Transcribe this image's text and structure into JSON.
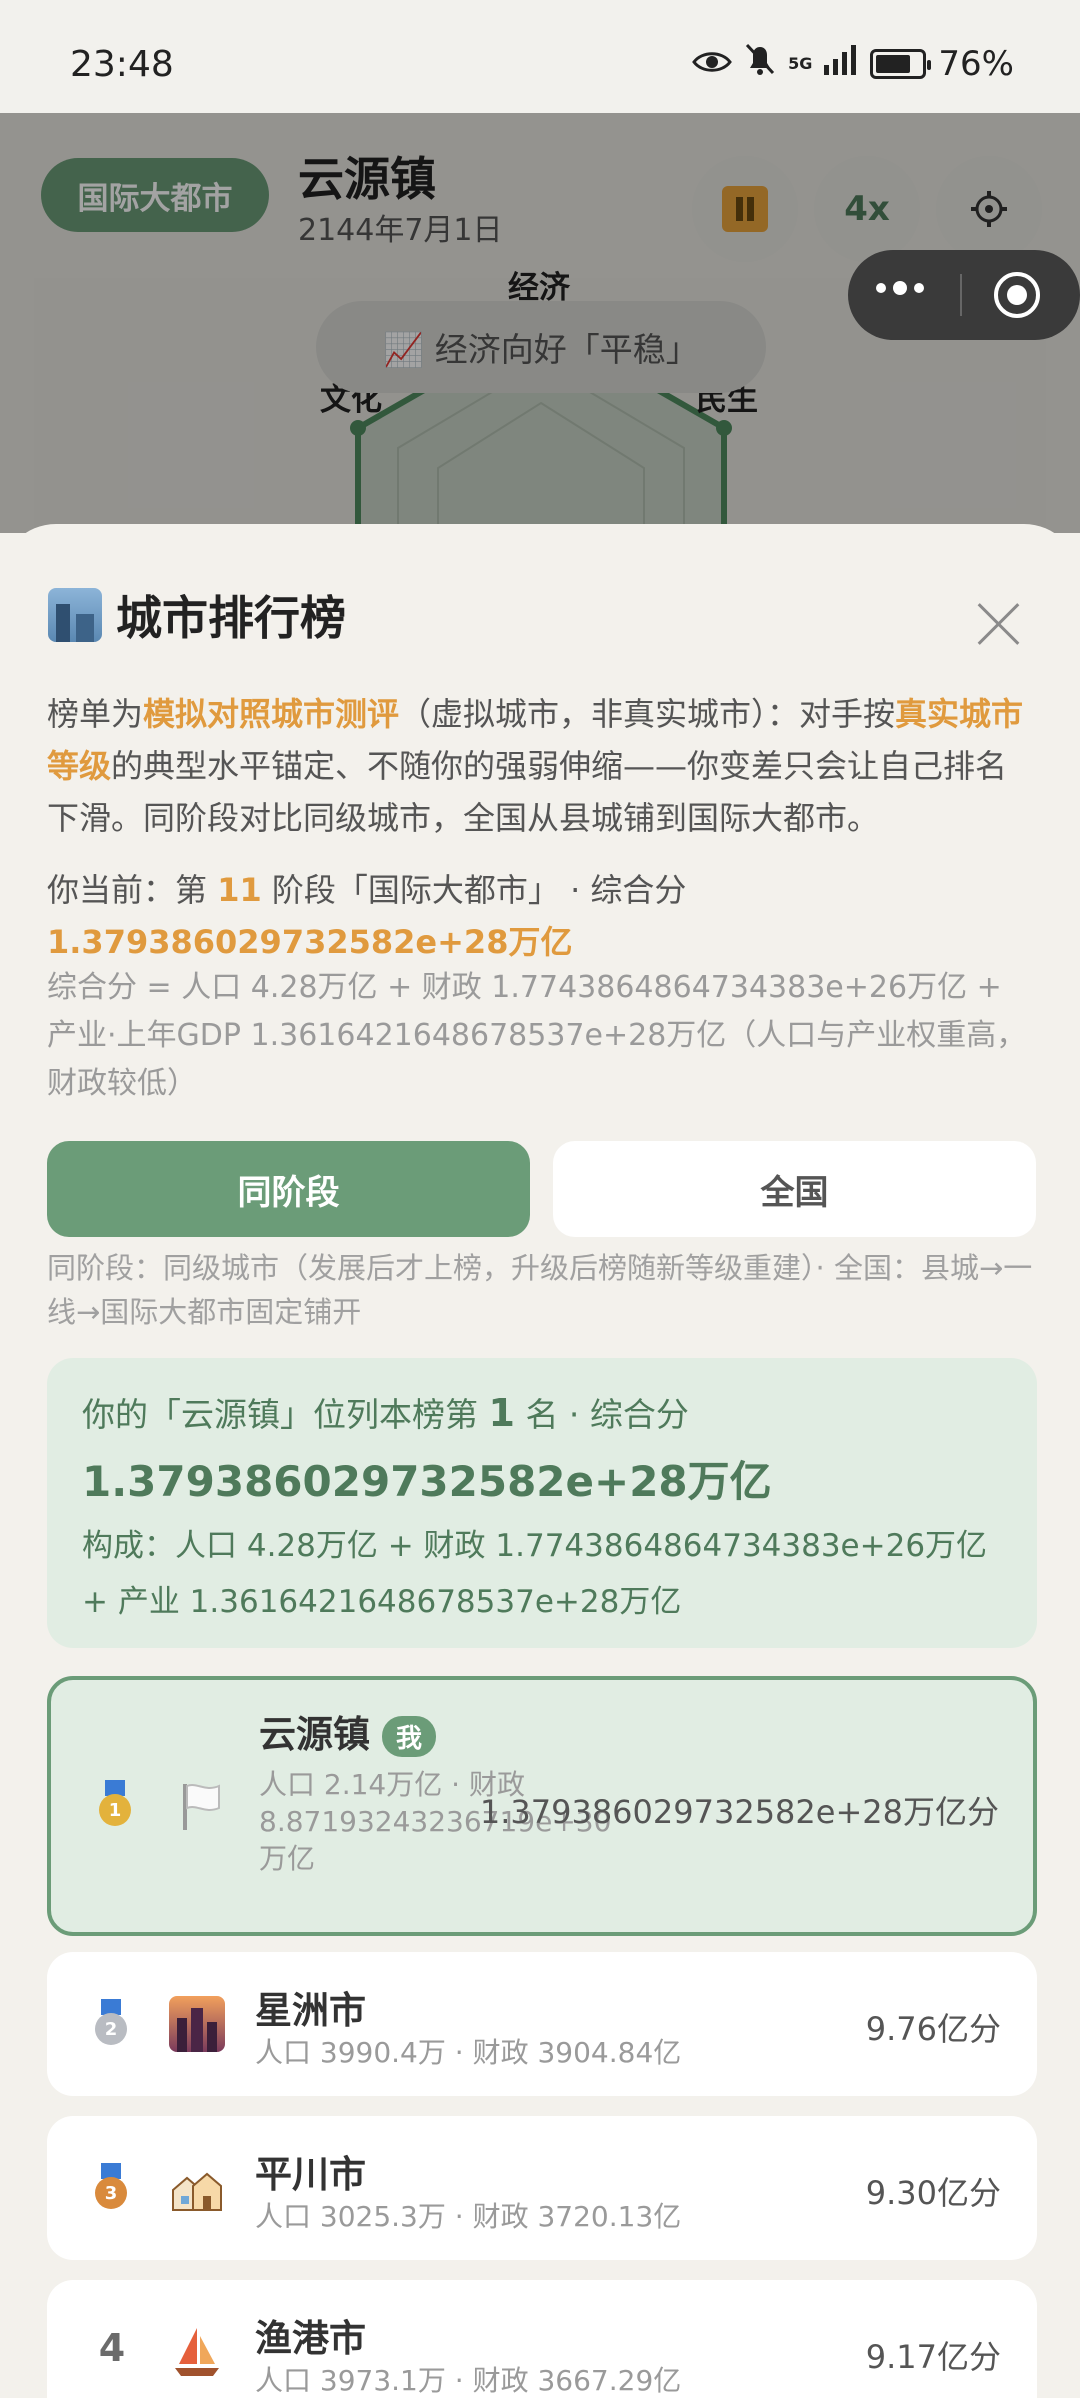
{
  "status": {
    "time": "23:48",
    "network": "5G",
    "battery": "76%",
    "battery_level": 0.76
  },
  "game": {
    "level_badge": "国际大都市",
    "town_name": "云源镇",
    "date": "2144年7月1日",
    "speed": "4x",
    "toast": "📈 经济向好「平稳」",
    "radar": {
      "top": "经济",
      "left": "文化",
      "right": "民生"
    }
  },
  "sheet": {
    "title": "城市排行榜",
    "intro": {
      "p1": "榜单为",
      "h1": "模拟对照城市测评",
      "p2": "（虚拟城市，非真实城市）：对手按",
      "h2": "真实城市等级",
      "p3": "的典型水平锚定、不随你的强弱伸缩——你变差只会让自己排名下滑。同阶段对比同级城市，全国从县城铺到国际大都市。"
    },
    "current": {
      "prefix": "你当前：第 ",
      "stage": "11",
      "middle": " 阶段「国际大都市」 · 综合分",
      "score": "1.379386029732582e+28万亿"
    },
    "formula": "综合分 = 人口 4.28万亿 + 财政 1.7743864864734383e+26万亿 + 产业·上年GDP 1.3616421648678537e+28万亿（人口与产业权重高，财政较低）",
    "tabs": {
      "stage": "同阶段",
      "national": "全国"
    },
    "tab_note": "同阶段：同级城市（发展后才上榜，升级后榜随新等级重建）· 全国：县城→一线→国际大都市固定铺开",
    "summary": {
      "line1_a": "你的「云源镇」位列本榜第 ",
      "line1_rank": "1",
      "line1_b": " 名 · 综合分",
      "score": "1.379386029732582e+28万亿",
      "composition": "构成：人口 4.28万亿 + 财政 1.7743864864734383e+26万亿 + 产业 1.3616421648678537e+28万亿"
    },
    "me_tag": "我",
    "rows": [
      {
        "rank": "1",
        "name": "云源镇",
        "sub": "人口 2.14万亿 · 财政 8.87193243236719e+30万亿",
        "score": "1.379386029732582e+28万亿分"
      },
      {
        "rank": "2",
        "name": "星洲市",
        "sub": "人口 3990.4万 · 财政 3904.84亿",
        "score": "9.76亿分"
      },
      {
        "rank": "3",
        "name": "平川市",
        "sub": "人口 3025.3万 · 财政 3720.13亿",
        "score": "9.30亿分"
      },
      {
        "rank": "4",
        "name": "渔港市",
        "sub": "人口 3973.1万 · 财政 3667.29亿",
        "score": "9.17亿分"
      }
    ],
    "colors": {
      "accent": "#6b9c78",
      "highlight": "#e09a3e"
    }
  }
}
